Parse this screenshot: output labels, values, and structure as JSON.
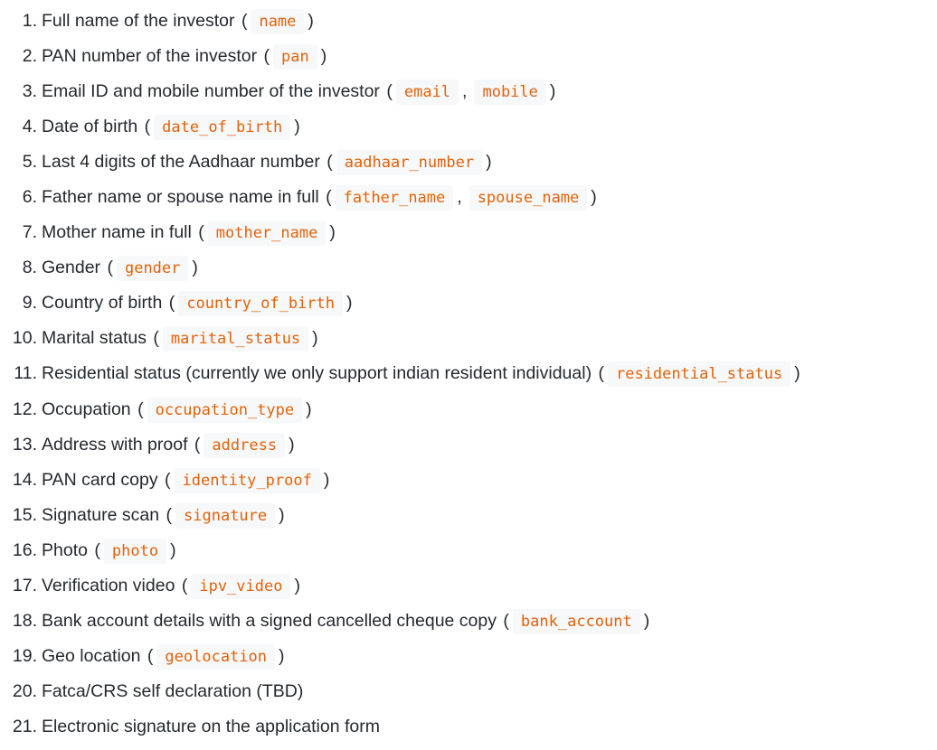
{
  "items": [
    {
      "number": "1",
      "text": "Full name of the investor",
      "fields": [
        "name"
      ]
    },
    {
      "number": "2",
      "text": "PAN number of the investor",
      "fields": [
        "pan"
      ]
    },
    {
      "number": "3",
      "text": "Email ID and mobile number of the investor",
      "fields": [
        "email",
        "mobile"
      ]
    },
    {
      "number": "4",
      "text": "Date of birth",
      "fields": [
        "date_of_birth"
      ]
    },
    {
      "number": "5",
      "text": "Last 4 digits of the Aadhaar number",
      "fields": [
        "aadhaar_number"
      ]
    },
    {
      "number": "6",
      "text": "Father name or spouse name in full",
      "fields": [
        "father_name",
        "spouse_name"
      ]
    },
    {
      "number": "7",
      "text": "Mother name in full",
      "fields": [
        "mother_name"
      ]
    },
    {
      "number": "8",
      "text": "Gender",
      "fields": [
        "gender"
      ]
    },
    {
      "number": "9",
      "text": "Country of birth",
      "fields": [
        "country_of_birth"
      ]
    },
    {
      "number": "10",
      "text": "Marital status",
      "fields": [
        "marital_status"
      ]
    },
    {
      "number": "11",
      "text": "Residential status (currently we only support indian resident individual)",
      "fields": [
        "residential_status"
      ]
    },
    {
      "number": "12",
      "text": "Occupation",
      "fields": [
        "occupation_type"
      ]
    },
    {
      "number": "13",
      "text": "Address with proof",
      "fields": [
        "address"
      ]
    },
    {
      "number": "14",
      "text": "PAN card copy",
      "fields": [
        "identity_proof"
      ]
    },
    {
      "number": "15",
      "text": "Signature scan",
      "fields": [
        "signature"
      ]
    },
    {
      "number": "16",
      "text": "Photo",
      "fields": [
        "photo"
      ]
    },
    {
      "number": "17",
      "text": "Verification video",
      "fields": [
        "ipv_video"
      ]
    },
    {
      "number": "18",
      "text": "Bank account details with a signed cancelled cheque copy",
      "fields": [
        "bank_account"
      ]
    },
    {
      "number": "19",
      "text": "Geo location",
      "fields": [
        "geolocation"
      ]
    },
    {
      "number": "20",
      "text": "Fatca/CRS self declaration (TBD)",
      "fields": []
    },
    {
      "number": "21",
      "text": "Electronic signature on the application form",
      "fields": []
    }
  ]
}
